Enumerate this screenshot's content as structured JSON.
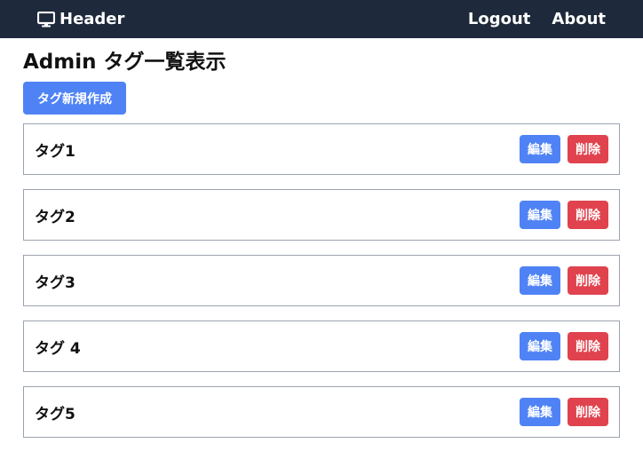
{
  "header": {
    "brand_label": "Header",
    "brand_icon": "monitor-icon",
    "nav": [
      {
        "label": "Logout"
      },
      {
        "label": "About"
      }
    ]
  },
  "main": {
    "title": "Admin タグ一覧表示",
    "create_button_label": "タグ新規作成",
    "tags": [
      {
        "name": "タグ1"
      },
      {
        "name": "タグ2"
      },
      {
        "name": "タグ3"
      },
      {
        "name": "タグ 4"
      },
      {
        "name": "タグ5"
      }
    ],
    "edit_label": "編集",
    "delete_label": "削除"
  },
  "colors": {
    "navbar_bg": "#1e293b",
    "primary": "#4f83f5",
    "danger": "#e0434e",
    "row_border": "#9ca3af"
  }
}
